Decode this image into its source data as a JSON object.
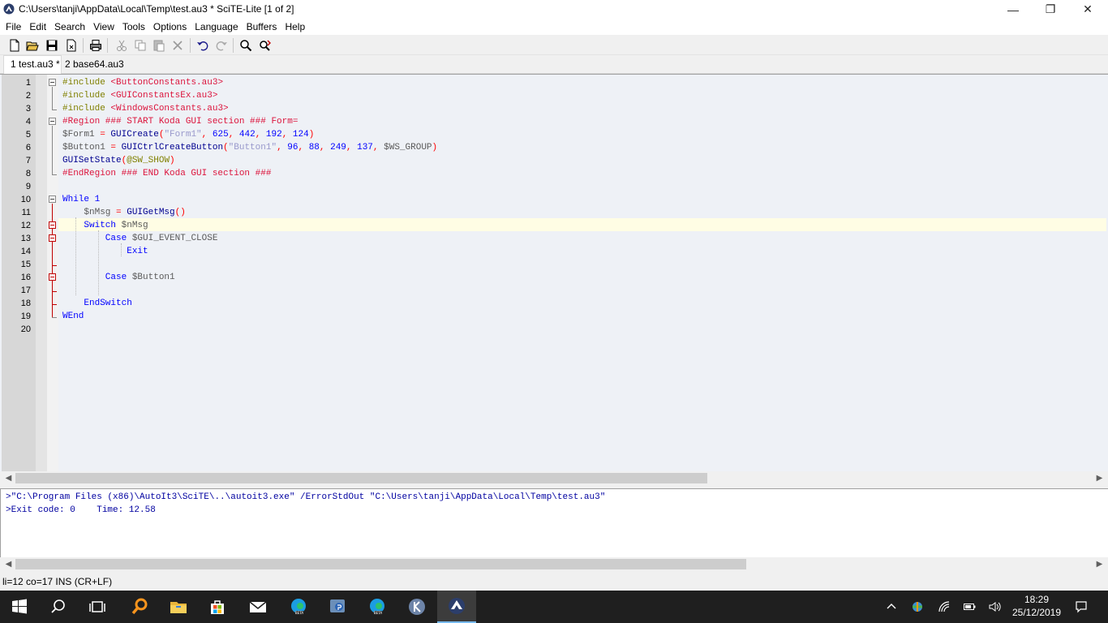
{
  "window": {
    "title": "C:\\Users\\tanji\\AppData\\Local\\Temp\\test.au3 * SciTE-Lite [1 of 2]",
    "min_glyph": "—",
    "max_glyph": "❐",
    "close_glyph": "✕"
  },
  "menu": [
    "File",
    "Edit",
    "Search",
    "View",
    "Tools",
    "Options",
    "Language",
    "Buffers",
    "Help"
  ],
  "toolbar": {
    "icons": [
      "new-file-icon",
      "open-folder-icon",
      "save-icon",
      "close-file-icon",
      "print-icon",
      "cut-icon",
      "copy-icon",
      "paste-icon",
      "delete-icon",
      "undo-icon",
      "redo-icon",
      "find-icon",
      "replace-icon"
    ]
  },
  "tabs": [
    {
      "label": "1 test.au3 *",
      "active": true
    },
    {
      "label": "2 base64.au3",
      "active": false
    }
  ],
  "editor": {
    "line_numbers": [
      "1",
      "2",
      "3",
      "4",
      "5",
      "6",
      "7",
      "8",
      "9",
      "10",
      "11",
      "12",
      "13",
      "14",
      "15",
      "16",
      "17",
      "18",
      "19",
      "20"
    ],
    "current_line": 12,
    "lines": [
      [
        [
          "t-pre",
          "#include "
        ],
        [
          "t-inc",
          "<ButtonConstants.au3>"
        ]
      ],
      [
        [
          "t-pre",
          "#include "
        ],
        [
          "t-inc",
          "<GUIConstantsEx.au3>"
        ]
      ],
      [
        [
          "t-pre",
          "#include "
        ],
        [
          "t-inc",
          "<WindowsConstants.au3>"
        ]
      ],
      [
        [
          "t-reg",
          "#Region ### START Koda GUI section ### Form="
        ]
      ],
      [
        [
          "t-var",
          "$Form1 "
        ],
        [
          "t-op",
          "= "
        ],
        [
          "t-fn",
          "GUICreate"
        ],
        [
          "t-op",
          "("
        ],
        [
          "t-str",
          "\"Form1\""
        ],
        [
          "t-op",
          ", "
        ],
        [
          "t-num",
          "625"
        ],
        [
          "t-op",
          ", "
        ],
        [
          "t-num",
          "442"
        ],
        [
          "t-op",
          ", "
        ],
        [
          "t-num",
          "192"
        ],
        [
          "t-op",
          ", "
        ],
        [
          "t-num",
          "124"
        ],
        [
          "t-op",
          ")"
        ]
      ],
      [
        [
          "t-var",
          "$Button1 "
        ],
        [
          "t-op",
          "= "
        ],
        [
          "t-fn",
          "GUICtrlCreateButton"
        ],
        [
          "t-op",
          "("
        ],
        [
          "t-str",
          "\"Button1\""
        ],
        [
          "t-op",
          ", "
        ],
        [
          "t-num",
          "96"
        ],
        [
          "t-op",
          ", "
        ],
        [
          "t-num",
          "88"
        ],
        [
          "t-op",
          ", "
        ],
        [
          "t-num",
          "249"
        ],
        [
          "t-op",
          ", "
        ],
        [
          "t-num",
          "137"
        ],
        [
          "t-op",
          ", "
        ],
        [
          "t-var",
          "$WS_GROUP"
        ],
        [
          "t-op",
          ")"
        ]
      ],
      [
        [
          "t-fn",
          "GUISetState"
        ],
        [
          "t-op",
          "("
        ],
        [
          "t-mac",
          "@SW_SHOW"
        ],
        [
          "t-op",
          ")"
        ]
      ],
      [
        [
          "t-reg",
          "#EndRegion ### END Koda GUI section ###"
        ]
      ],
      [],
      [
        [
          "t-kw",
          "While "
        ],
        [
          "t-num",
          "1"
        ]
      ],
      [
        [
          "t-var",
          "    $nMsg "
        ],
        [
          "t-op",
          "= "
        ],
        [
          "t-fn",
          "GUIGetMsg"
        ],
        [
          "t-op",
          "()"
        ]
      ],
      [
        [
          "t-kw",
          "    Switch "
        ],
        [
          "t-var",
          "$nMsg"
        ]
      ],
      [
        [
          "t-kw",
          "        Case "
        ],
        [
          "t-var",
          "$GUI_EVENT_CLOSE"
        ]
      ],
      [
        [
          "t-kw",
          "            Exit"
        ]
      ],
      [],
      [
        [
          "t-kw",
          "        Case "
        ],
        [
          "t-var",
          "$Button1"
        ]
      ],
      [],
      [
        [
          "t-kw",
          "    EndSwitch"
        ]
      ],
      [
        [
          "t-kw",
          "WEnd"
        ]
      ],
      []
    ]
  },
  "output": {
    "lines": [
      ">\"C:\\Program Files (x86)\\AutoIt3\\SciTE\\..\\autoit3.exe\" /ErrorStdOut \"C:\\Users\\tanji\\AppData\\Local\\Temp\\test.au3\"",
      ">Exit code: 0    Time: 12.58"
    ]
  },
  "status": "li=12 co=17 INS (CR+LF)",
  "taskbar": {
    "apps": [
      "windows-start-icon",
      "search-icon",
      "task-view-icon",
      "search-app-icon",
      "file-explorer-icon",
      "store-icon",
      "mail-icon",
      "edge-beta-icon",
      "remote-app-icon",
      "edge-beta-2-icon",
      "k-app-icon",
      "scite-icon"
    ],
    "clock_time": "18:29",
    "clock_date": "25/12/2019"
  }
}
